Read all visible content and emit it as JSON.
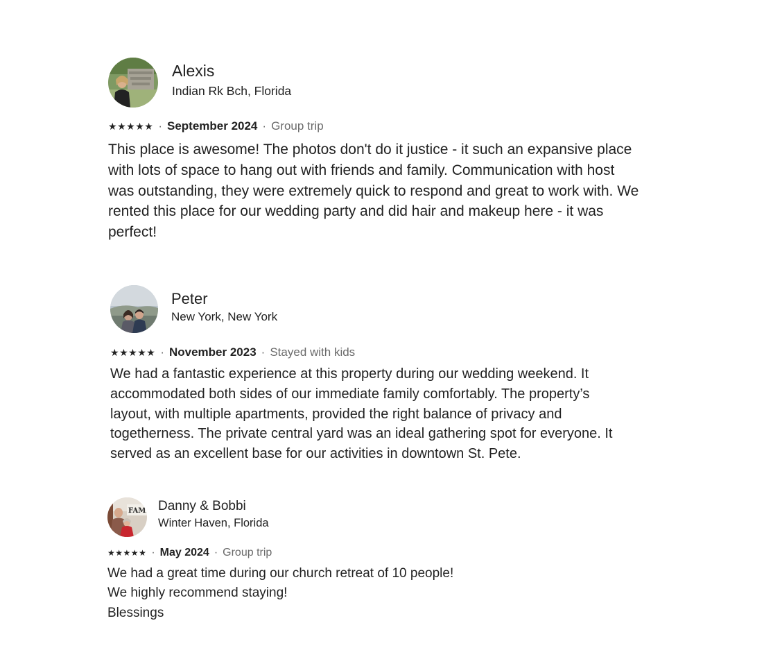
{
  "reviews": [
    {
      "name": "Alexis",
      "location": "Indian Rk Bch, Florida",
      "rating_stars": 5,
      "date": "September 2024",
      "trip_type": "Group trip",
      "separator": "·",
      "star_glyph": "★",
      "avatar_icon": "avatar-photo-ruins",
      "text_lines": [
        "This place is awesome! The photos don't do it justice - it such an expansive place",
        "with lots of space to hang out with friends and family. Communication with host",
        "was outstanding, they were extremely quick to respond and great to work with. We",
        "rented this place for our wedding party and did hair and makeup here - it was",
        "perfect!"
      ]
    },
    {
      "name": "Peter",
      "location": "New York, New York",
      "rating_stars": 5,
      "date": "November 2023",
      "trip_type": "Stayed with kids",
      "separator": "·",
      "star_glyph": "★",
      "avatar_icon": "avatar-photo-couple",
      "text_lines": [
        "We had a fantastic experience at this property during our wedding weekend. It",
        "accommodated both sides of our immediate family comfortably. The property’s",
        "layout, with multiple apartments, provided the right balance of privacy and",
        "togetherness. The private central yard was an ideal gathering spot for everyone. It",
        "served as an excellent base for our activities in downtown St. Pete."
      ]
    },
    {
      "name": "Danny & Bobbi",
      "location": "Winter Haven, Florida",
      "rating_stars": 5,
      "date": "May 2024",
      "trip_type": "Group trip",
      "separator": "·",
      "star_glyph": "★",
      "avatar_icon": "avatar-photo-family-sign",
      "avatar_sign_text": "FAMI",
      "text_lines": [
        "We had a great time during our church retreat of 10 people!",
        "We highly recommend staying!",
        "Blessings"
      ]
    }
  ]
}
